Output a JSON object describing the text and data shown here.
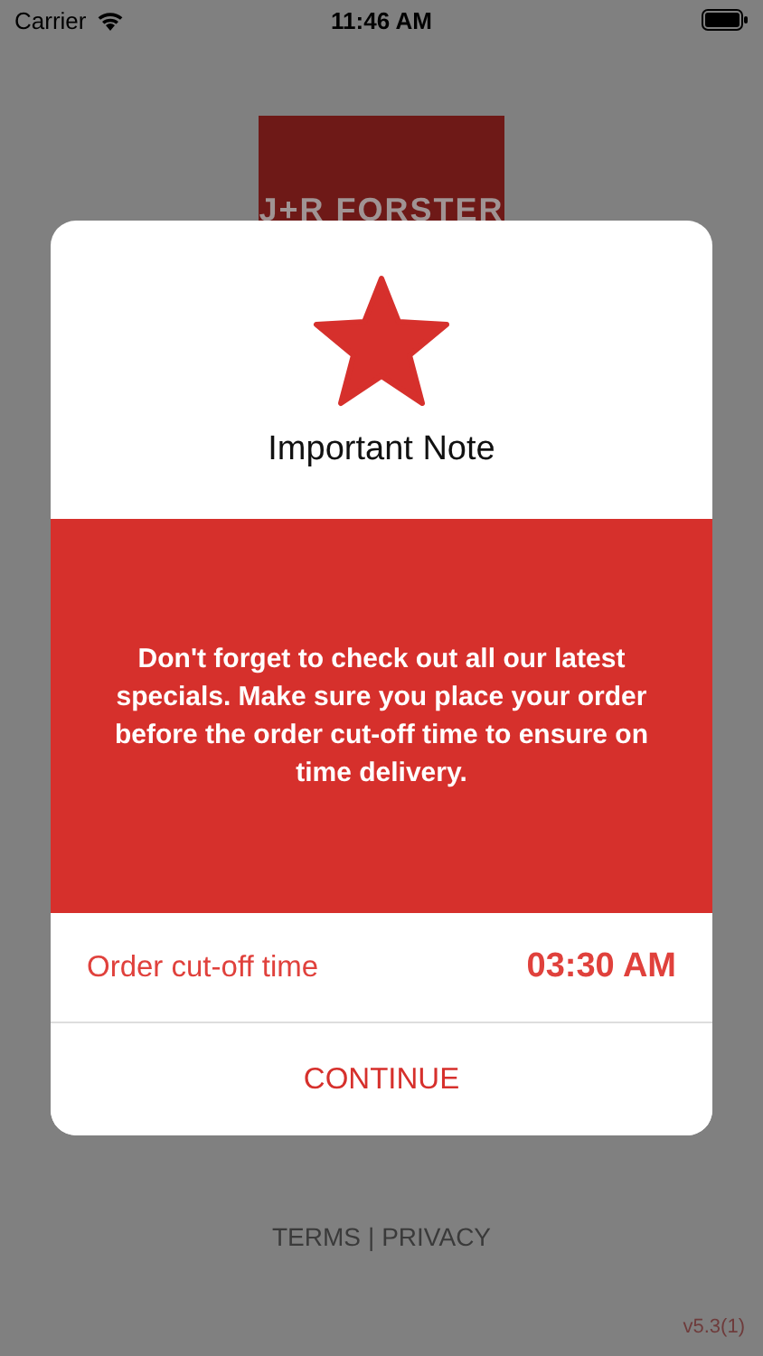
{
  "status_bar": {
    "carrier": "Carrier",
    "time": "11:46 AM"
  },
  "logo": {
    "text": "J+R FORSTER"
  },
  "dialog": {
    "title": "Important Note",
    "message": "Don't forget to check out all our latest specials. Make sure you place your order before the order cut-off time to ensure on time delivery.",
    "cutoff_label": "Order cut-off time",
    "cutoff_time": "03:30 AM",
    "button": "CONTINUE"
  },
  "footer": {
    "links": [
      "TERMS",
      "PRIVACY"
    ],
    "separator": "|",
    "version": "v5.3(1)"
  }
}
